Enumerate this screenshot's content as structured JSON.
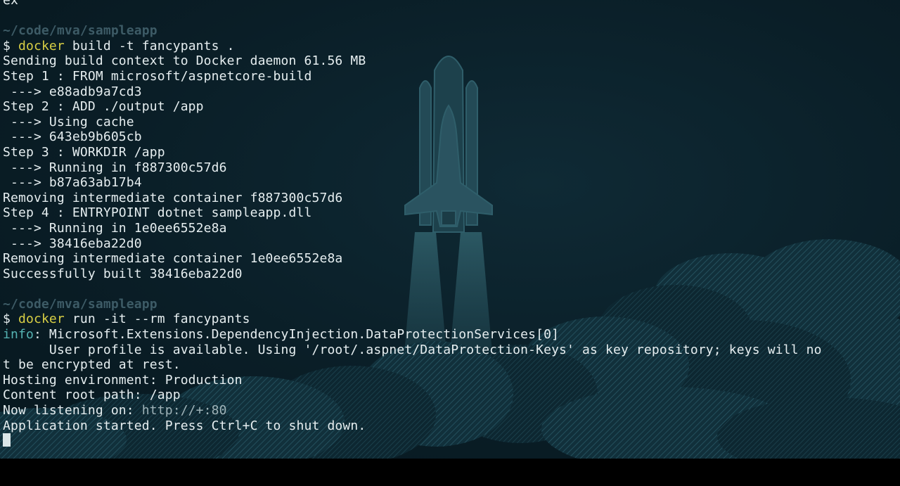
{
  "terminal": {
    "lines": [
      {
        "text": "ex"
      },
      {
        "text": ""
      },
      {
        "text": "~/code/mva/sampleapp",
        "kind": "path"
      },
      {
        "prompt": "$ ",
        "cmd": "docker",
        "args": " build -t fancypants ."
      },
      {
        "text": "Sending build context to Docker daemon 61.56 MB"
      },
      {
        "text": "Step 1 : FROM microsoft/aspnetcore-build"
      },
      {
        "text": " ---> e88adb9a7cd3"
      },
      {
        "text": "Step 2 : ADD ./output /app"
      },
      {
        "text": " ---> Using cache"
      },
      {
        "text": " ---> 643eb9b605cb"
      },
      {
        "text": "Step 3 : WORKDIR /app"
      },
      {
        "text": " ---> Running in f887300c57d6"
      },
      {
        "text": " ---> b87a63ab17b4"
      },
      {
        "text": "Removing intermediate container f887300c57d6"
      },
      {
        "text": "Step 4 : ENTRYPOINT dotnet sampleapp.dll"
      },
      {
        "text": " ---> Running in 1e0ee6552e8a"
      },
      {
        "text": " ---> 38416eba22d0"
      },
      {
        "text": "Removing intermediate container 1e0ee6552e8a"
      },
      {
        "text": "Successfully built 38416eba22d0"
      },
      {
        "text": ""
      },
      {
        "text": "~/code/mva/sampleapp",
        "kind": "path"
      },
      {
        "prompt": "$ ",
        "cmd": "docker",
        "args": " run -it --rm fancypants"
      },
      {
        "info": "info",
        "rest": ": Microsoft.Extensions.DependencyInjection.DataProtectionServices[0]"
      },
      {
        "text": "      User profile is available. Using '/root/.aspnet/DataProtection-Keys' as key repository; keys will no"
      },
      {
        "text": "t be encrypted at rest."
      },
      {
        "text": "Hosting environment: Production"
      },
      {
        "text": "Content root path: /app"
      },
      {
        "before": "Now listening on: ",
        "link": "http://+:80"
      },
      {
        "text": "Application started. Press Ctrl+C to shut down."
      }
    ]
  },
  "colors": {
    "background": "#0a1e27",
    "prompt_path": "#3d5b66",
    "command": "#d8cf45",
    "info": "#55b3b3",
    "foreground": "#e6eef0"
  },
  "wallpaper": {
    "icon": "space-shuttle-launch-illustration"
  }
}
